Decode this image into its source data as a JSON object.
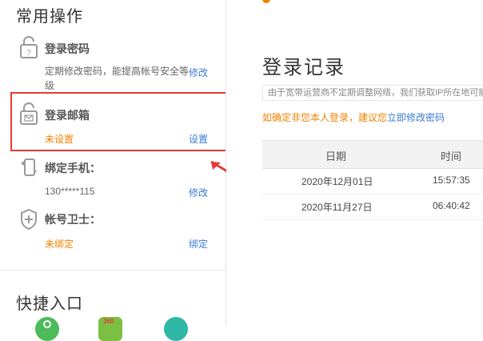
{
  "left": {
    "common_ops_title": "常用操作",
    "items": [
      {
        "title": "登录密码",
        "desc": "定期修改密码，能提高帐号安全等级",
        "action": "修改",
        "icon": "lock-question-icon"
      },
      {
        "title": "登录邮箱",
        "status": "未设置",
        "action": "设置",
        "icon": "lock-mail-icon"
      },
      {
        "title": "绑定手机：",
        "value": "130*****115",
        "action": "修改",
        "icon": "phone-swap-icon"
      },
      {
        "title": "帐号卫士：",
        "status": "未绑定",
        "action": "绑定",
        "icon": "shield-plus-icon"
      }
    ],
    "quick_title": "快捷入口",
    "quick_icons": [
      "green-app-icon",
      "360-app-icon",
      "teal-app-icon"
    ],
    "quick_badge": "360"
  },
  "right": {
    "title": "登录记录",
    "notice": "由于宽带运营商不定期调整网络，我们获取IP所在地可能有误差",
    "warn_prefix": "如确定非您本人登录，建议您",
    "warn_link": "立即修改密码",
    "columns": [
      "日期",
      "时间"
    ],
    "rows": [
      {
        "date": "2020年12月01日",
        "time": "15:57:35"
      },
      {
        "date": "2020年11月27日",
        "time": "06:40:42"
      }
    ]
  },
  "colors": {
    "accent_orange": "#f08200",
    "link_blue": "#3b7bd6",
    "highlight_red": "#e53935"
  }
}
